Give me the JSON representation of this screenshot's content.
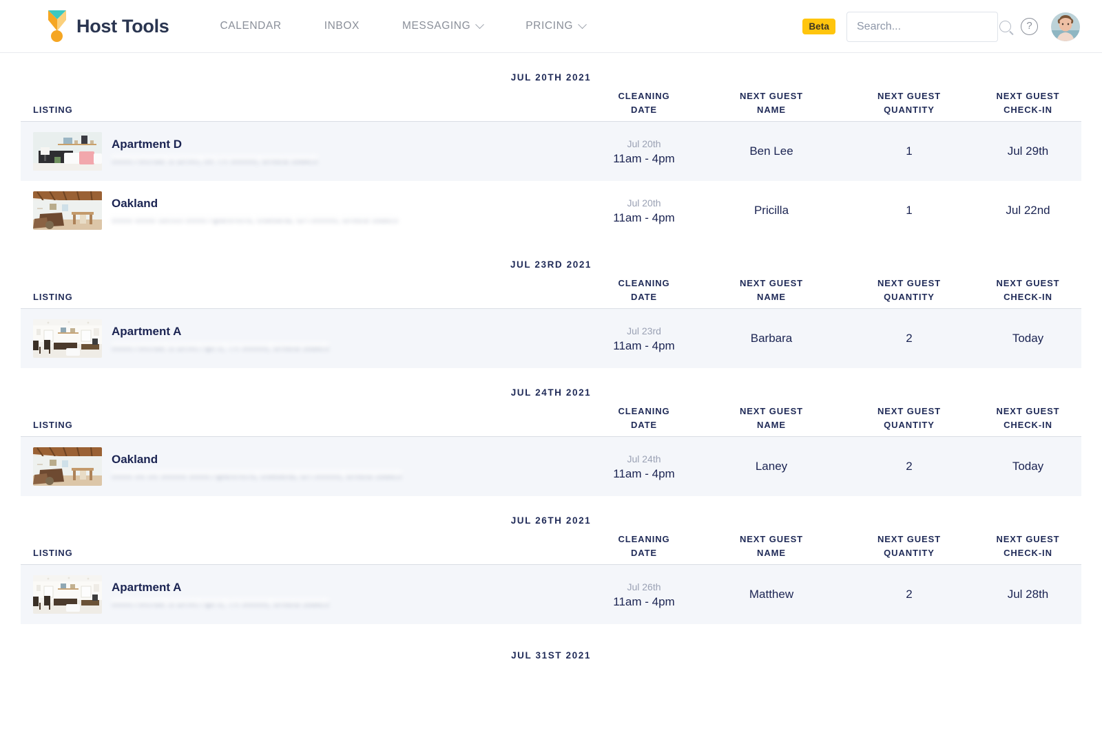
{
  "header": {
    "brand_name": "Host Tools",
    "logo_icon": "medal-ribbon-icon",
    "nav": [
      {
        "label": "CALENDAR",
        "has_chevron": false,
        "icon": ""
      },
      {
        "label": "INBOX",
        "has_chevron": false,
        "icon": ""
      },
      {
        "label": "MESSAGING",
        "has_chevron": true,
        "icon": "chevron-down-icon"
      },
      {
        "label": "PRICING",
        "has_chevron": true,
        "icon": "chevron-down-icon"
      }
    ],
    "beta_badge": "Beta",
    "search": {
      "value": "",
      "placeholder": "Search...",
      "icon": "search-icon"
    },
    "help_icon_label": "?",
    "avatar_label": "user-avatar"
  },
  "colors": {
    "brand_navy": "#2a3550",
    "logo_teal": "#3cc8c0",
    "logo_orange": "#f5a623",
    "beta_yellow": "#ffc50d",
    "text_navy": "#1b2452",
    "muted": "#9aa1b4",
    "row_highlight": "#f4f6fa",
    "nav_gray": "#8a8f99"
  },
  "columns": {
    "listing": "LISTING",
    "cleaning_date_l1": "CLEANING",
    "cleaning_date_l2": "DATE",
    "guest_name_l1": "NEXT GUEST",
    "guest_name_l2": "NAME",
    "guest_qty_l1": "NEXT GUEST",
    "guest_qty_l2": "QUANTITY",
    "guest_checkin_l1": "NEXT GUEST",
    "guest_checkin_l2": "CHECK-IN"
  },
  "sections": [
    {
      "date": "JUL 20TH 2021",
      "rows": [
        {
          "thumb": "bedroom-shelf-photo",
          "listing": "Apartment D",
          "address": "0000 Avenue S Drive, 0x TX 00000, United States",
          "cleaning_date": "Jul 20th",
          "cleaning_time": "11am - 4pm",
          "guest_name": "Ben Lee",
          "guest_quantity": "1",
          "guest_checkin": "Jul 29th",
          "highlight": true
        },
        {
          "thumb": "living-room-beams-photo",
          "listing": "Oakland",
          "address": "0000 0000 Street 0000 Apartment, Oakland, CA 00000, United States",
          "cleaning_date": "Jul 20th",
          "cleaning_time": "11am - 4pm",
          "guest_name": "Pricilla",
          "guest_quantity": "1",
          "guest_checkin": "Jul 22nd",
          "highlight": false
        }
      ]
    },
    {
      "date": "JUL 23RD 2021",
      "rows": [
        {
          "thumb": "dining-apartment-photo",
          "listing": "Apartment A",
          "address": "0000 Avenue S Drive Apt 0, TX 00000, United States",
          "cleaning_date": "Jul 23rd",
          "cleaning_time": "11am - 4pm",
          "guest_name": "Barbara",
          "guest_quantity": "2",
          "guest_checkin": "Today",
          "highlight": true
        }
      ]
    },
    {
      "date": "JUL 24TH 2021",
      "rows": [
        {
          "thumb": "living-room-beams-photo",
          "listing": "Oakland",
          "address": "0000 00 00 00000 0000 Apartment, Oakland, CA 00000, United States",
          "cleaning_date": "Jul 24th",
          "cleaning_time": "11am - 4pm",
          "guest_name": "Laney",
          "guest_quantity": "2",
          "guest_checkin": "Today",
          "highlight": true
        }
      ]
    },
    {
      "date": "JUL 26TH 2021",
      "rows": [
        {
          "thumb": "dining-apartment-photo",
          "listing": "Apartment A",
          "address": "0000 Avenue S Drive Apt 0, TX 00000, United States",
          "cleaning_date": "Jul 26th",
          "cleaning_time": "11am - 4pm",
          "guest_name": "Matthew",
          "guest_quantity": "2",
          "guest_checkin": "Jul 28th",
          "highlight": true
        }
      ]
    }
  ],
  "clipped_section_date": "JUL 31ST 2021"
}
